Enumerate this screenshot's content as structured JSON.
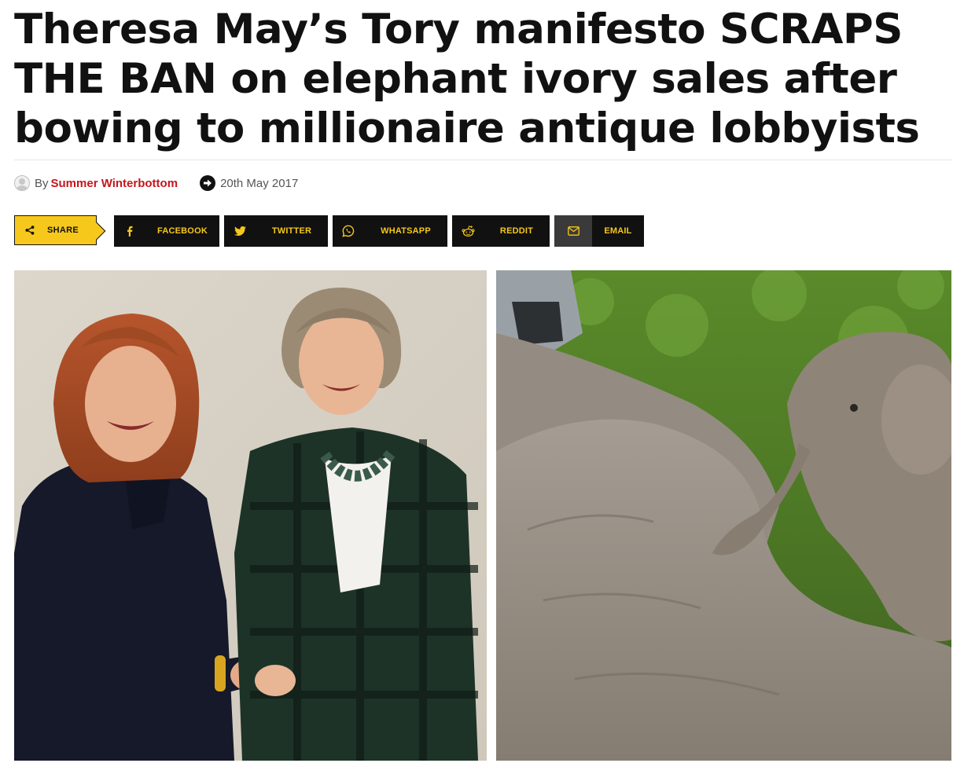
{
  "article": {
    "headline": "Theresa May’s Tory manifesto SCRAPS THE BAN on elephant ivory sales after bowing to millionaire antique lobbyists",
    "byline_prefix": "By",
    "author": "Summer Winterbottom",
    "date": "20th May 2017"
  },
  "share": {
    "label": "SHARE",
    "buttons": [
      {
        "label": "FACEBOOK",
        "icon": "facebook-icon"
      },
      {
        "label": "TWITTER",
        "icon": "twitter-icon"
      },
      {
        "label": "WHATSAPP",
        "icon": "whatsapp-icon"
      },
      {
        "label": "REDDIT",
        "icon": "reddit-icon"
      },
      {
        "label": "EMAIL",
        "icon": "envelope-icon"
      }
    ]
  },
  "images": [
    {
      "subject": "two women shaking hands"
    },
    {
      "subject": "baby elephant beside fallen elephants"
    }
  ],
  "colors": {
    "accent": "#f6c81b",
    "button_bg": "#111111",
    "author_link": "#c4161c"
  }
}
